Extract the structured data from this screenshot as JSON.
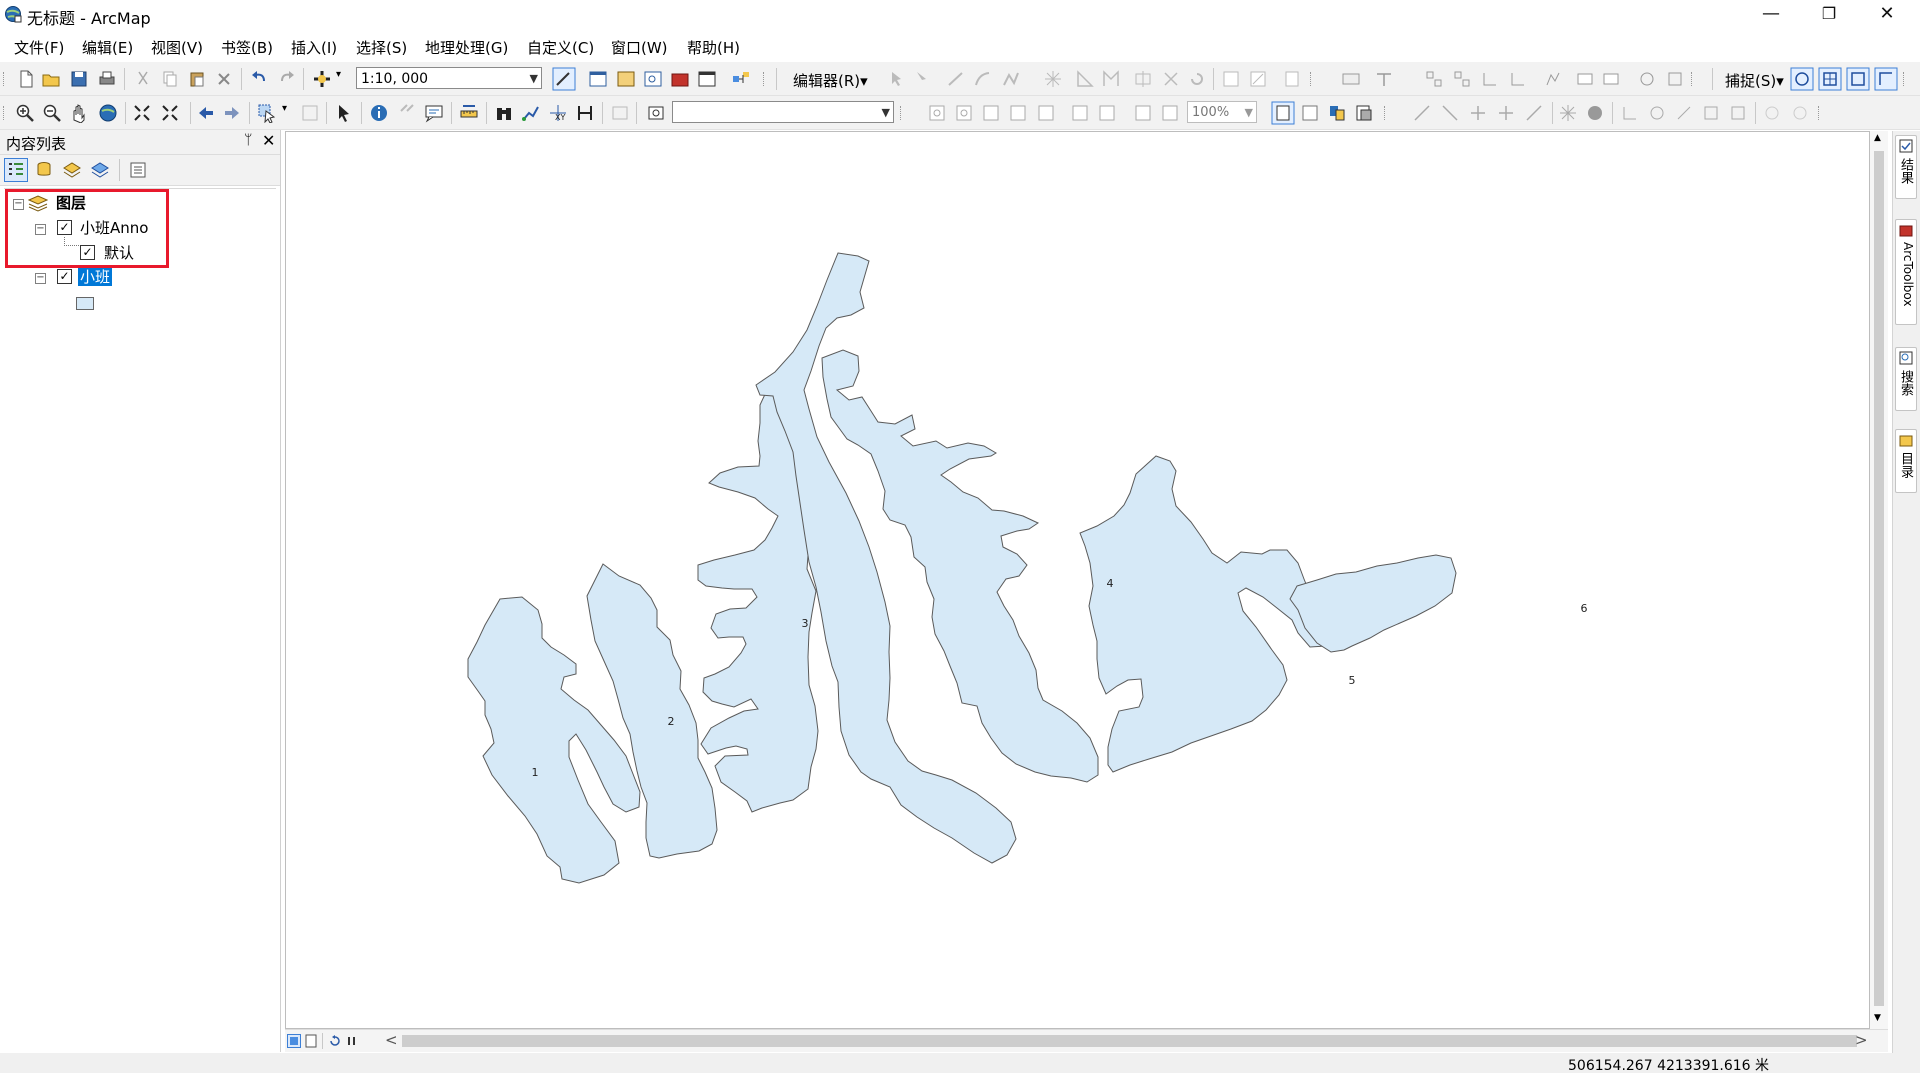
{
  "window": {
    "title": "无标题 - ArcMap",
    "minimize_glyph": "—",
    "restore_glyph": "❐",
    "close_glyph": "✕"
  },
  "menu": [
    {
      "label": "文件(F)"
    },
    {
      "label": "编辑(E)"
    },
    {
      "label": "视图(V)"
    },
    {
      "label": "书签(B)"
    },
    {
      "label": "插入(I)"
    },
    {
      "label": "选择(S)"
    },
    {
      "label": "地理处理(G)"
    },
    {
      "label": "自定义(C)"
    },
    {
      "label": "窗口(W)"
    },
    {
      "label": "帮助(H)"
    }
  ],
  "toolbar": {
    "scale_value": "1:10, 000",
    "editor_label": "编辑器(R)▾",
    "snapping_label": "捕捉(S)▾",
    "zoom_value": "100%",
    "layer_combo_value": ""
  },
  "toc": {
    "title": "内容列表",
    "pin_glyph": "ᛘ",
    "close_glyph": "✕",
    "layers": {
      "root_label": "图层",
      "anno_layer": {
        "label": "小班Anno",
        "checked": true
      },
      "anno_class": {
        "label": "默认",
        "checked": true
      },
      "polygon_layer": {
        "label": "小班",
        "checked": true,
        "selected": true
      }
    },
    "expander_minus": "−",
    "check_glyph": "✓"
  },
  "map": {
    "fill_color": "#d6e9f7",
    "stroke_color": "#5a5a5a",
    "labels": [
      "1",
      "2",
      "3",
      "4",
      "5",
      "6"
    ]
  },
  "right_dock": {
    "tabs": [
      {
        "label": "结果"
      },
      {
        "label": "ArcToolbox"
      },
      {
        "label": "搜索"
      },
      {
        "label": "目录"
      }
    ]
  },
  "scrollbar": {
    "left_arrow": "<",
    "right_arrow": ">",
    "up_arrow": "▲",
    "down_arrow": "▼"
  },
  "status": {
    "coordinates": "506154.267  4213391.616 米"
  },
  "colors": {
    "highlight_box": "#e8192c",
    "selection_blue": "#0078d7",
    "polygon_fill": "#d6e9f7"
  }
}
